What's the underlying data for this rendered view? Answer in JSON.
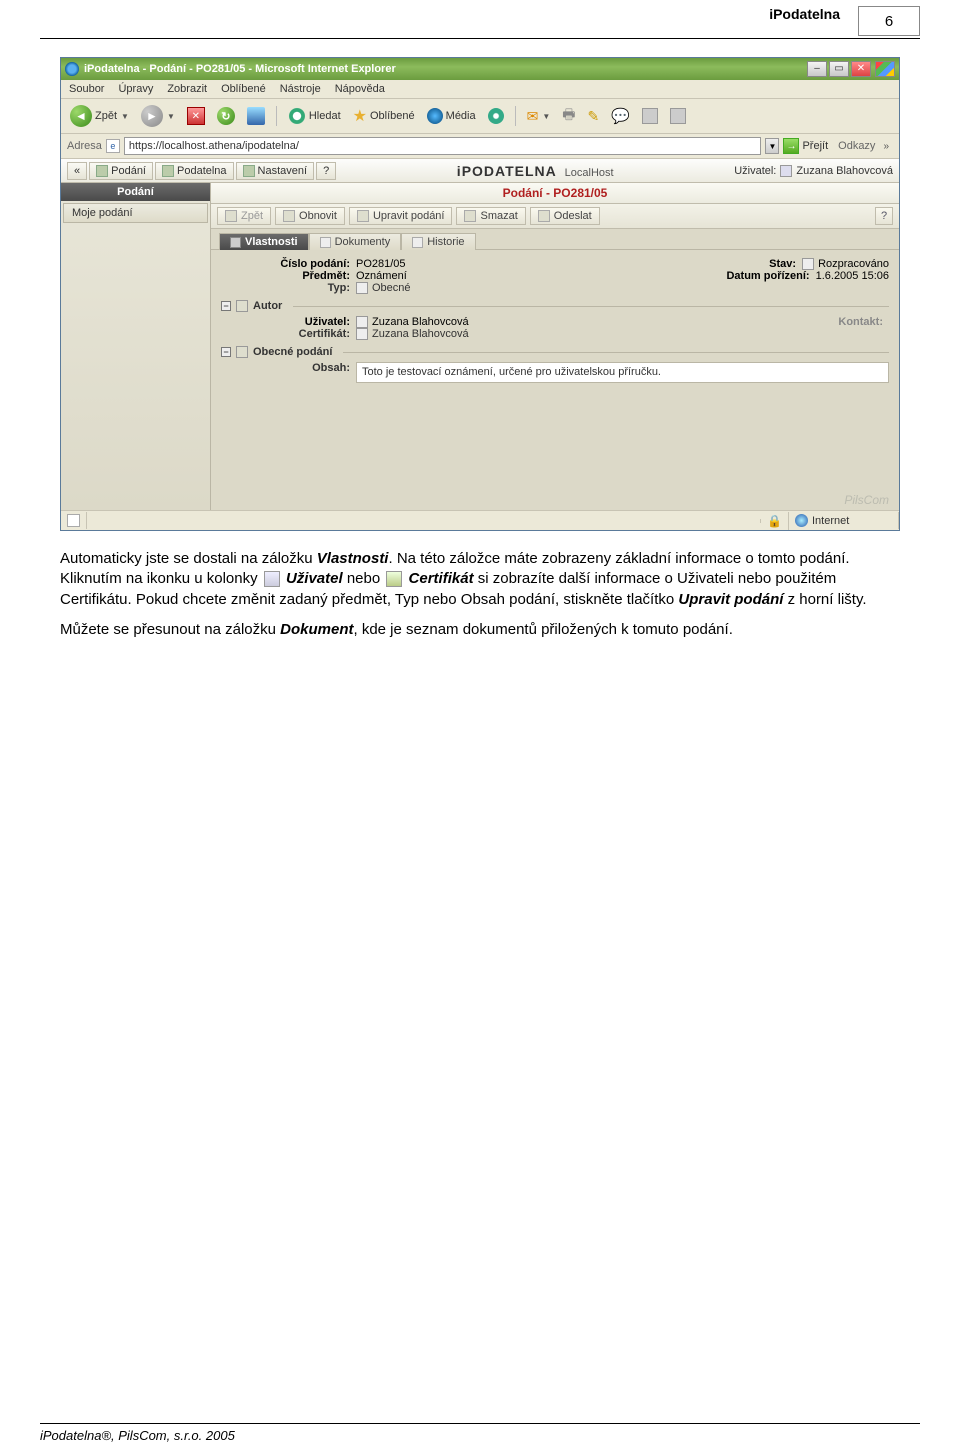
{
  "page": {
    "header_label": "iPodatelna",
    "page_number": "6",
    "footer": "iPodatelna®, PilsCom, s.r.o. 2005"
  },
  "browser": {
    "window_title": "iPodatelna - Podání - PO281/05 - Microsoft Internet Explorer",
    "menu": [
      "Soubor",
      "Úpravy",
      "Zobrazit",
      "Oblíbené",
      "Nástroje",
      "Nápověda"
    ],
    "toolbar": {
      "back": "Zpět",
      "search": "Hledat",
      "favorites": "Oblíbené",
      "media": "Média"
    },
    "address_label": "Adresa",
    "address_url": "https://localhost.athena/ipodatelna/",
    "go_label": "Přejít",
    "links_label": "Odkazy"
  },
  "app": {
    "nav": {
      "podani": "Podání",
      "podatelna": "Podatelna",
      "nastaveni": "Nastavení",
      "help": "?"
    },
    "logo_prefix": "i",
    "logo_word": "PODATELNA",
    "host": "LocalHost",
    "user_label": "Uživatel:",
    "user_name": "Zuzana Blahovcová"
  },
  "sidebar": {
    "title": "Podání",
    "items": [
      "Moje podání"
    ]
  },
  "content": {
    "title": "Podání - PO281/05",
    "actions": {
      "zpet": "Zpět",
      "obnovit": "Obnovit",
      "upravit": "Upravit podání",
      "smazat": "Smazat",
      "odeslat": "Odeslat"
    },
    "tabs": {
      "vlastnosti": "Vlastnosti",
      "dokumenty": "Dokumenty",
      "historie": "Historie"
    },
    "fields": {
      "cislo_label": "Číslo podání:",
      "cislo_value": "PO281/05",
      "stav_label": "Stav:",
      "stav_value": "Rozpracováno",
      "predmet_label": "Předmět:",
      "predmet_value": "Oznámení",
      "datum_label": "Datum pořízení:",
      "datum_value": "1.6.2005 15:06",
      "typ_label": "Typ:",
      "typ_value": "Obecné"
    },
    "section_autor": "Autor",
    "autor": {
      "uzivatel_label": "Uživatel:",
      "uzivatel_value": "Zuzana Blahovcová",
      "kontakt_label": "Kontakt:",
      "certifikat_label": "Certifikát:",
      "certifikat_value": "Zuzana Blahovcová"
    },
    "section_obecne": "Obecné podání",
    "obecne": {
      "obsah_label": "Obsah:",
      "obsah_value": "Toto je testovací oznámení, určené pro uživatelskou příručku."
    },
    "watermark": "PilsCom"
  },
  "statusbar": {
    "zone": "Internet"
  },
  "body": {
    "p1a": "Automaticky jste se dostali na záložku ",
    "p1b": "Vlastnosti",
    "p1c": ". Na této záložce máte zobrazeny základní informace o tomto podání. Kliknutím na ikonku u kolonky ",
    "p1d": "Uživatel",
    "p1e": " nebo ",
    "p1f": "Certifikát",
    "p1g": " si zobrazíte další informace o Uživateli nebo použitém Certifikátu. Pokud chcete změnit zadaný předmět, Typ nebo Obsah podání, stiskněte tlačítko ",
    "p1h": "Upravit podání",
    "p1i": " z horní lišty.",
    "p2a": "Můžete se přesunout na záložku ",
    "p2b": "Dokument",
    "p2c": ", kde je seznam dokumentů přiložených k tomuto podání."
  }
}
